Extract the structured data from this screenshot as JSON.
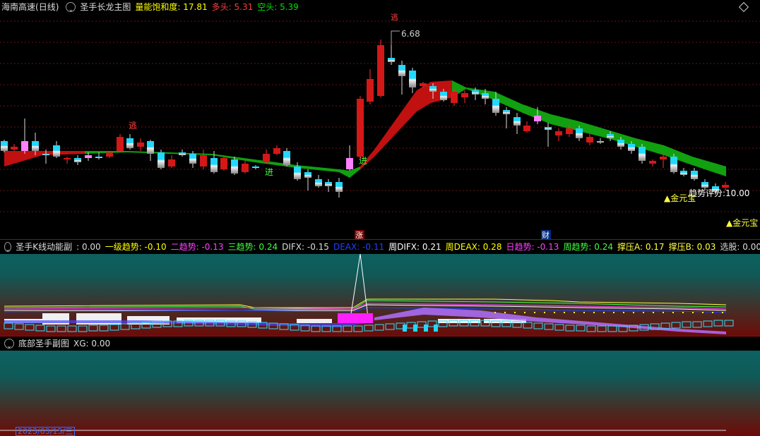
{
  "main": {
    "stock_name": "海南高速",
    "period": "(日线)",
    "indicator": "圣手长龙主图",
    "items": [
      {
        "label": "量能饱和度:",
        "value": "17.81",
        "color": "#ffff00"
      },
      {
        "label": "多头:",
        "value": "5.31",
        "color": "#ff3b3b"
      },
      {
        "label": "空头:",
        "value": "5.39",
        "color": "#00e000"
      }
    ],
    "annotations": {
      "high": "6.68",
      "escape": "逃",
      "enter1": "进",
      "enter2": "进",
      "trend": "趋势评分:10.00",
      "gold1": "▲金元宝",
      "gold2": "▲金元宝",
      "zhang": "涨",
      "cai": "财",
      "top_mark": "逃"
    }
  },
  "sub1": {
    "indicator": "圣手K线动能副",
    "items": [
      {
        "label": ":",
        "value": "0.00",
        "color": "#dddddd"
      },
      {
        "label": "一级趋势:",
        "value": "-0.10",
        "color": "#ffff00"
      },
      {
        "label": "二趋势:",
        "value": "-0.13",
        "color": "#ff40ff"
      },
      {
        "label": "三趋势:",
        "value": "0.24",
        "color": "#40ff40"
      },
      {
        "label": "DIFX:",
        "value": "-0.15",
        "color": "#dddddd"
      },
      {
        "label": "DEAX:",
        "value": "-0.11",
        "color": "#2040ff"
      },
      {
        "label": "周DIFX:",
        "value": "0.21",
        "color": "#ffffff"
      },
      {
        "label": "周DEAX:",
        "value": "0.28",
        "color": "#ffff00"
      },
      {
        "label": "日趋势:",
        "value": "-0.13",
        "color": "#ff40ff"
      },
      {
        "label": "周趋势:",
        "value": "0.24",
        "color": "#40ff40"
      },
      {
        "label": "撑压A:",
        "value": "0.17",
        "color": "#ffff40"
      },
      {
        "label": "撑压B:",
        "value": "0.03",
        "color": "#ffff40"
      },
      {
        "label": "选股:",
        "value": "0.00",
        "color": "#dddddd"
      }
    ]
  },
  "sub2": {
    "indicator": "底部圣手副图",
    "items": [
      {
        "label": "XG:",
        "value": "0.00",
        "color": "#dddddd"
      }
    ],
    "date": "2023/03/15/三"
  }
}
